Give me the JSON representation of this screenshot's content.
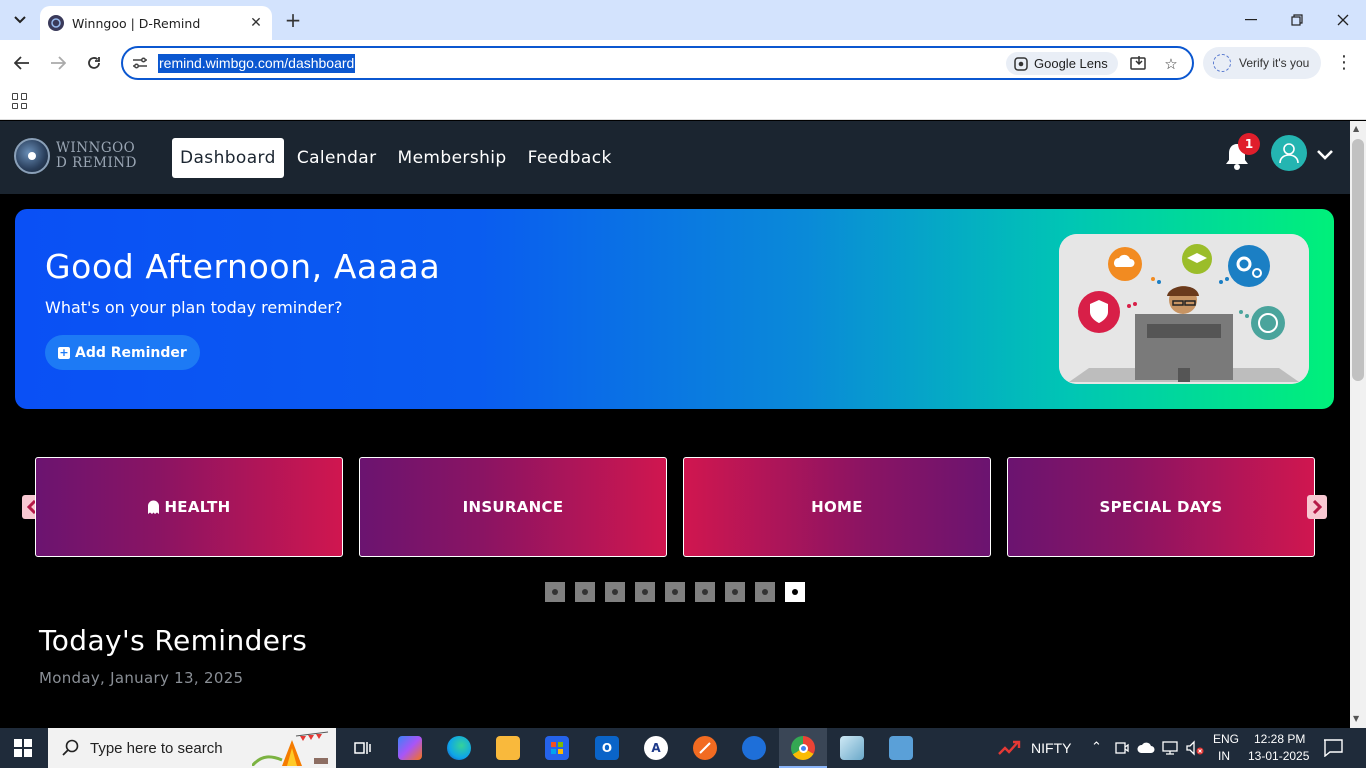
{
  "browser": {
    "tab_title": "Winngoo | D-Remind",
    "url": "remind.wimbgo.com/dashboard",
    "lens_label": "Google Lens",
    "verify_label": "Verify it's you"
  },
  "site": {
    "logo_line1": "WINNGOO",
    "logo_line2": "D REMIND",
    "nav": [
      "Dashboard",
      "Calendar",
      "Membership",
      "Feedback"
    ],
    "active_nav": "Dashboard",
    "notification_count": "1"
  },
  "hero": {
    "greeting": "Good Afternoon, Aaaaa",
    "subtitle": "What's on your plan today reminder?",
    "add_button": "Add Reminder"
  },
  "categories": [
    "HEALTH",
    "INSURANCE",
    "HOME",
    "SPECIAL DAYS"
  ],
  "carousel": {
    "total_dots": 9,
    "active_dot": 9
  },
  "today": {
    "title": "Today's Reminders",
    "date": "Monday, January 13, 2025"
  },
  "taskbar": {
    "search_placeholder": "Type here to search",
    "ticker": "NIFTY",
    "lang1": "ENG",
    "lang2": "IN",
    "time": "12:28 PM",
    "date": "13-01-2025"
  },
  "colors": {
    "nav_bg": "#1b2530",
    "hero_start": "#0a50f5",
    "hero_end": "#00f07a",
    "category_pink": "#d0164f",
    "category_purple": "#6b1470",
    "badge_red": "#e01e2b",
    "avatar_teal": "#24b5b1"
  }
}
